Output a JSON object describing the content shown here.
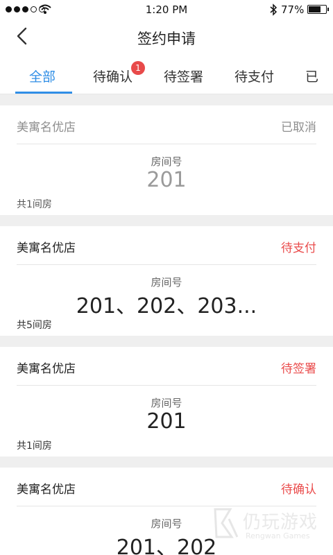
{
  "status_bar": {
    "time": "1:20 PM",
    "battery_percent": "77%",
    "battery_level": 0.77,
    "signal_bars_filled": 3,
    "signal_bars_total": 5,
    "icons": [
      "signal-icon",
      "wifi-icon",
      "bluetooth-icon",
      "battery-icon"
    ]
  },
  "nav": {
    "title": "签约申请",
    "back_icon": "chevron-left-icon"
  },
  "tabs": [
    {
      "label": "全部",
      "active": true
    },
    {
      "label": "待确认",
      "badge": "1"
    },
    {
      "label": "待签署"
    },
    {
      "label": "待支付"
    },
    {
      "label": "已"
    }
  ],
  "cards": [
    {
      "store": "美寓名优店",
      "status": "已取消",
      "room_label": "房间号",
      "rooms": "201",
      "count": "共1间房"
    },
    {
      "store": "美寓名优店",
      "status": "待支付",
      "room_label": "房间号",
      "rooms": "201、202、203...",
      "count": "共5间房"
    },
    {
      "store": "美寓名优店",
      "status": "待签署",
      "room_label": "房间号",
      "rooms": "201",
      "count": "共1间房"
    },
    {
      "store": "美寓名优店",
      "status": "待确认",
      "room_label": "房间号",
      "rooms": "201、202",
      "count": ""
    }
  ],
  "watermark": {
    "title": "仍玩游戏",
    "subtitle": "Rengwan Games"
  },
  "colors": {
    "accent": "#2f8ee6",
    "status_red": "#ea4b4b",
    "muted_gray": "#8e8e8e",
    "badge_red": "#e84a4a",
    "background": "#efefef"
  }
}
